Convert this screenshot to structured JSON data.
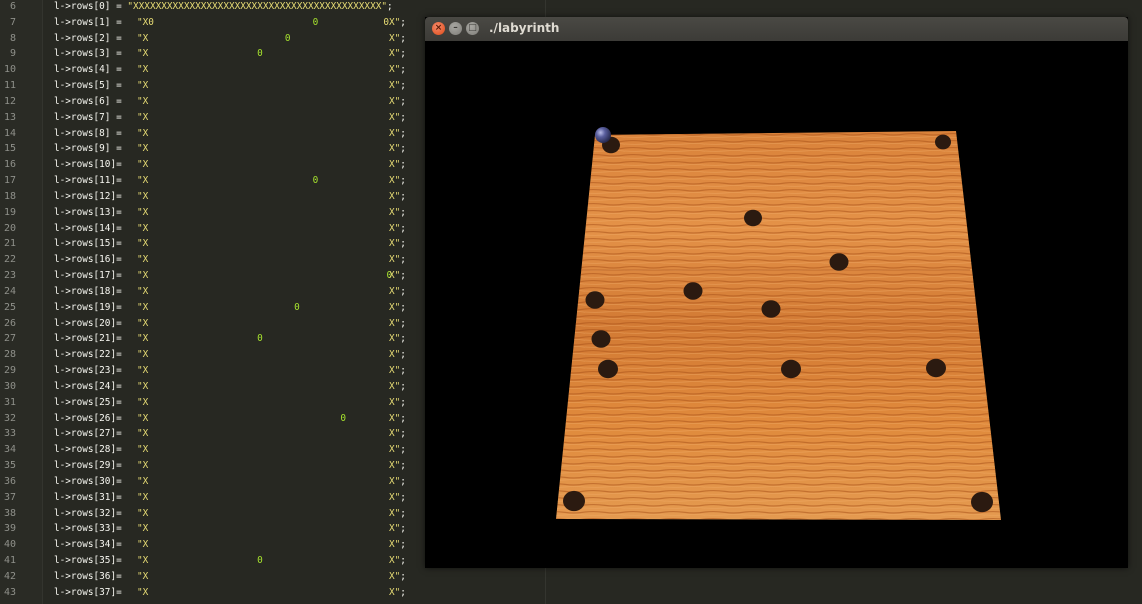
{
  "editor": {
    "first_line_number": 6,
    "lines": [
      {
        "lhs": "l->rows[0] = ",
        "str": "\"XXXXXXXXXXXXXXXXXXXXXXXXXXXXXXXXXXXXXXXXXXXX\"",
        "semi": ";",
        "full": true
      },
      {
        "lhs": "l->rows[1] = ",
        "start": "\"X0",
        "holes": [
          [
            19
          ]
        ],
        "end": "0X\"",
        "semi": ";"
      },
      {
        "lhs": "l->rows[2] = ",
        "start": "\"X",
        "holes": [
          [
            16
          ]
        ],
        "end": "X\"",
        "semi": ";"
      },
      {
        "lhs": "l->rows[3] = ",
        "start": "\"X",
        "holes": [
          [
            13
          ]
        ],
        "end": "X\"",
        "semi": ";"
      },
      {
        "lhs": "l->rows[4] = ",
        "start": "\"X",
        "end": "X\"",
        "semi": ";"
      },
      {
        "lhs": "l->rows[5] = ",
        "start": "\"X",
        "end": "X\"",
        "semi": ";"
      },
      {
        "lhs": "l->rows[6] = ",
        "start": "\"X",
        "end": "X\"",
        "semi": ";"
      },
      {
        "lhs": "l->rows[7] = ",
        "start": "\"X",
        "end": "X\"",
        "semi": ";"
      },
      {
        "lhs": "l->rows[8] = ",
        "start": "\"X",
        "end": "X\"",
        "semi": ";"
      },
      {
        "lhs": "l->rows[9] = ",
        "start": "\"X",
        "end": "X\"",
        "semi": ";"
      },
      {
        "lhs": "l->rows[10]= ",
        "start": "\"X",
        "end": "X\"",
        "semi": ";"
      },
      {
        "lhs": "l->rows[11]= ",
        "start": "\"X",
        "holes": [
          [
            19
          ]
        ],
        "end": "X\"",
        "semi": ";"
      },
      {
        "lhs": "l->rows[12]= ",
        "start": "\"X",
        "end": "X\"",
        "semi": ";"
      },
      {
        "lhs": "l->rows[13]= ",
        "start": "\"X",
        "end": "X\"",
        "semi": ";"
      },
      {
        "lhs": "l->rows[14]= ",
        "start": "\"X",
        "end": "X\"",
        "semi": ";"
      },
      {
        "lhs": "l->rows[15]= ",
        "start": "\"X",
        "end": "X\"",
        "semi": ";"
      },
      {
        "lhs": "l->rows[16]= ",
        "start": "\"X",
        "end": "X\"",
        "semi": ";"
      },
      {
        "lhs": "l->rows[17]= ",
        "start": "\"X",
        "holes": [
          [
            27
          ]
        ],
        "end": "X\"",
        "semi": ";"
      },
      {
        "lhs": "l->rows[18]= ",
        "start": "\"X",
        "end": "X\"",
        "semi": ";"
      },
      {
        "lhs": "l->rows[19]= ",
        "start": "\"X",
        "holes": [
          [
            17
          ]
        ],
        "end": "X\"",
        "semi": ";"
      },
      {
        "lhs": "l->rows[20]= ",
        "start": "\"X",
        "end": "X\"",
        "semi": ";"
      },
      {
        "lhs": "l->rows[21]= ",
        "start": "\"X",
        "holes": [
          [
            13
          ]
        ],
        "end": "X\"",
        "semi": ";"
      },
      {
        "lhs": "l->rows[22]= ",
        "start": "\"X",
        "end": "X\"",
        "semi": ";"
      },
      {
        "lhs": "l->rows[23]= ",
        "start": "\"X",
        "end": "X\"",
        "semi": ";"
      },
      {
        "lhs": "l->rows[24]= ",
        "start": "\"X",
        "end": "X\"",
        "semi": ";"
      },
      {
        "lhs": "l->rows[25]= ",
        "start": "\"X",
        "end": "X\"",
        "semi": ";"
      },
      {
        "lhs": "l->rows[26]= ",
        "start": "\"X",
        "holes": [
          [
            22
          ]
        ],
        "end": "X\"",
        "semi": ";"
      },
      {
        "lhs": "l->rows[27]= ",
        "start": "\"X",
        "end": "X\"",
        "semi": ";"
      },
      {
        "lhs": "l->rows[28]= ",
        "start": "\"X",
        "end": "X\"",
        "semi": ";"
      },
      {
        "lhs": "l->rows[29]= ",
        "start": "\"X",
        "end": "X\"",
        "semi": ";"
      },
      {
        "lhs": "l->rows[30]= ",
        "start": "\"X",
        "end": "X\"",
        "semi": ";"
      },
      {
        "lhs": "l->rows[31]= ",
        "start": "\"X",
        "end": "X\"",
        "semi": ";"
      },
      {
        "lhs": "l->rows[32]= ",
        "start": "\"X",
        "end": "X\"",
        "semi": ";"
      },
      {
        "lhs": "l->rows[33]= ",
        "start": "\"X",
        "end": "X\"",
        "semi": ";"
      },
      {
        "lhs": "l->rows[34]= ",
        "start": "\"X",
        "end": "X\"",
        "semi": ";"
      },
      {
        "lhs": "l->rows[35]= ",
        "start": "\"X",
        "holes": [
          [
            13
          ]
        ],
        "end": "X\"",
        "semi": ";"
      },
      {
        "lhs": "l->rows[36]= ",
        "start": "\"X",
        "end": "X\"",
        "semi": ";"
      },
      {
        "lhs": "l->rows[37]= ",
        "start": "\"X",
        "end": "X\"",
        "semi": ";"
      }
    ],
    "hole_char": "0",
    "colors": {
      "background": "#272822",
      "text": "#f8f8f2",
      "index": "#ae81ff",
      "string": "#e6db74",
      "hole": "#a6e22e",
      "line_number": "#8f908a"
    }
  },
  "window": {
    "title": "./labyrinth",
    "close_glyph": "×",
    "min_glyph": "–",
    "max_glyph": "□",
    "board": {
      "wood_light": "#e08a3c",
      "wood_dark": "#b35a1e",
      "hole_color": "#2b1a10",
      "ball_color": "#4a4f8a"
    }
  }
}
